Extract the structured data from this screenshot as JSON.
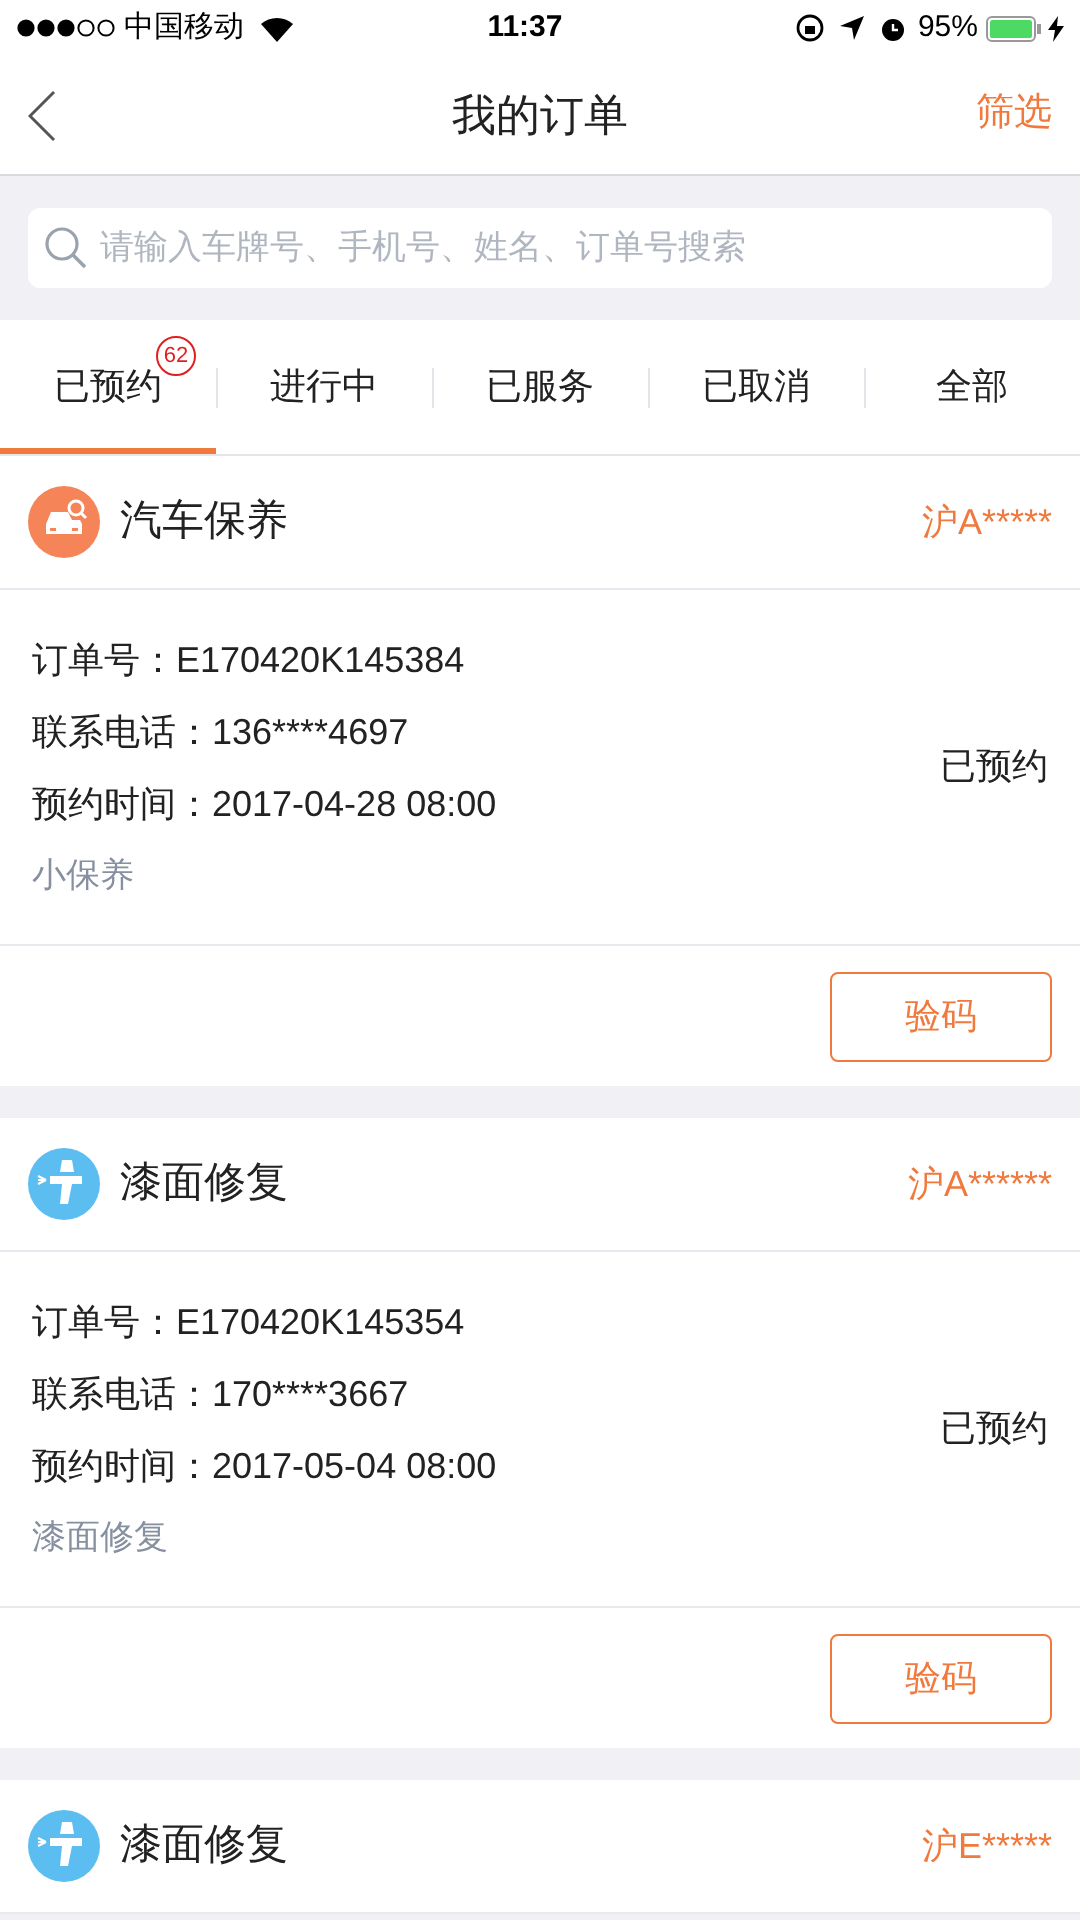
{
  "status_bar": {
    "carrier": "中国移动",
    "time": "11:37",
    "battery": "95%"
  },
  "nav": {
    "back": true,
    "title": "我的订单",
    "action": "筛选"
  },
  "search": {
    "placeholder": "请输入车牌号、手机号、姓名、订单号搜索"
  },
  "tabs": [
    {
      "label": "已预约",
      "selected": true,
      "badge": "62"
    },
    {
      "label": "进行中",
      "selected": false
    },
    {
      "label": "已服务",
      "selected": false
    },
    {
      "label": "已取消",
      "selected": false
    },
    {
      "label": "全部",
      "selected": false
    }
  ],
  "orders": [
    {
      "kind": "car",
      "service": "汽车保养",
      "plate": "沪A*****",
      "order_no": "订单号：E170420K145384",
      "phone": "联系电话：136****4697",
      "time": "预约时间：2017-04-28 08:00",
      "item": "小保养",
      "status": "已预约",
      "button": "验码"
    },
    {
      "kind": "paint",
      "service": "漆面修复",
      "plate": "沪A******",
      "order_no": "订单号：E170420K145354",
      "phone": "联系电话：170****3667",
      "time": "预约时间：2017-05-04 08:00",
      "item": "漆面修复",
      "status": "已预约",
      "button": "验码"
    },
    {
      "kind": "paint",
      "service": "漆面修复",
      "plate": "沪E*****"
    }
  ]
}
